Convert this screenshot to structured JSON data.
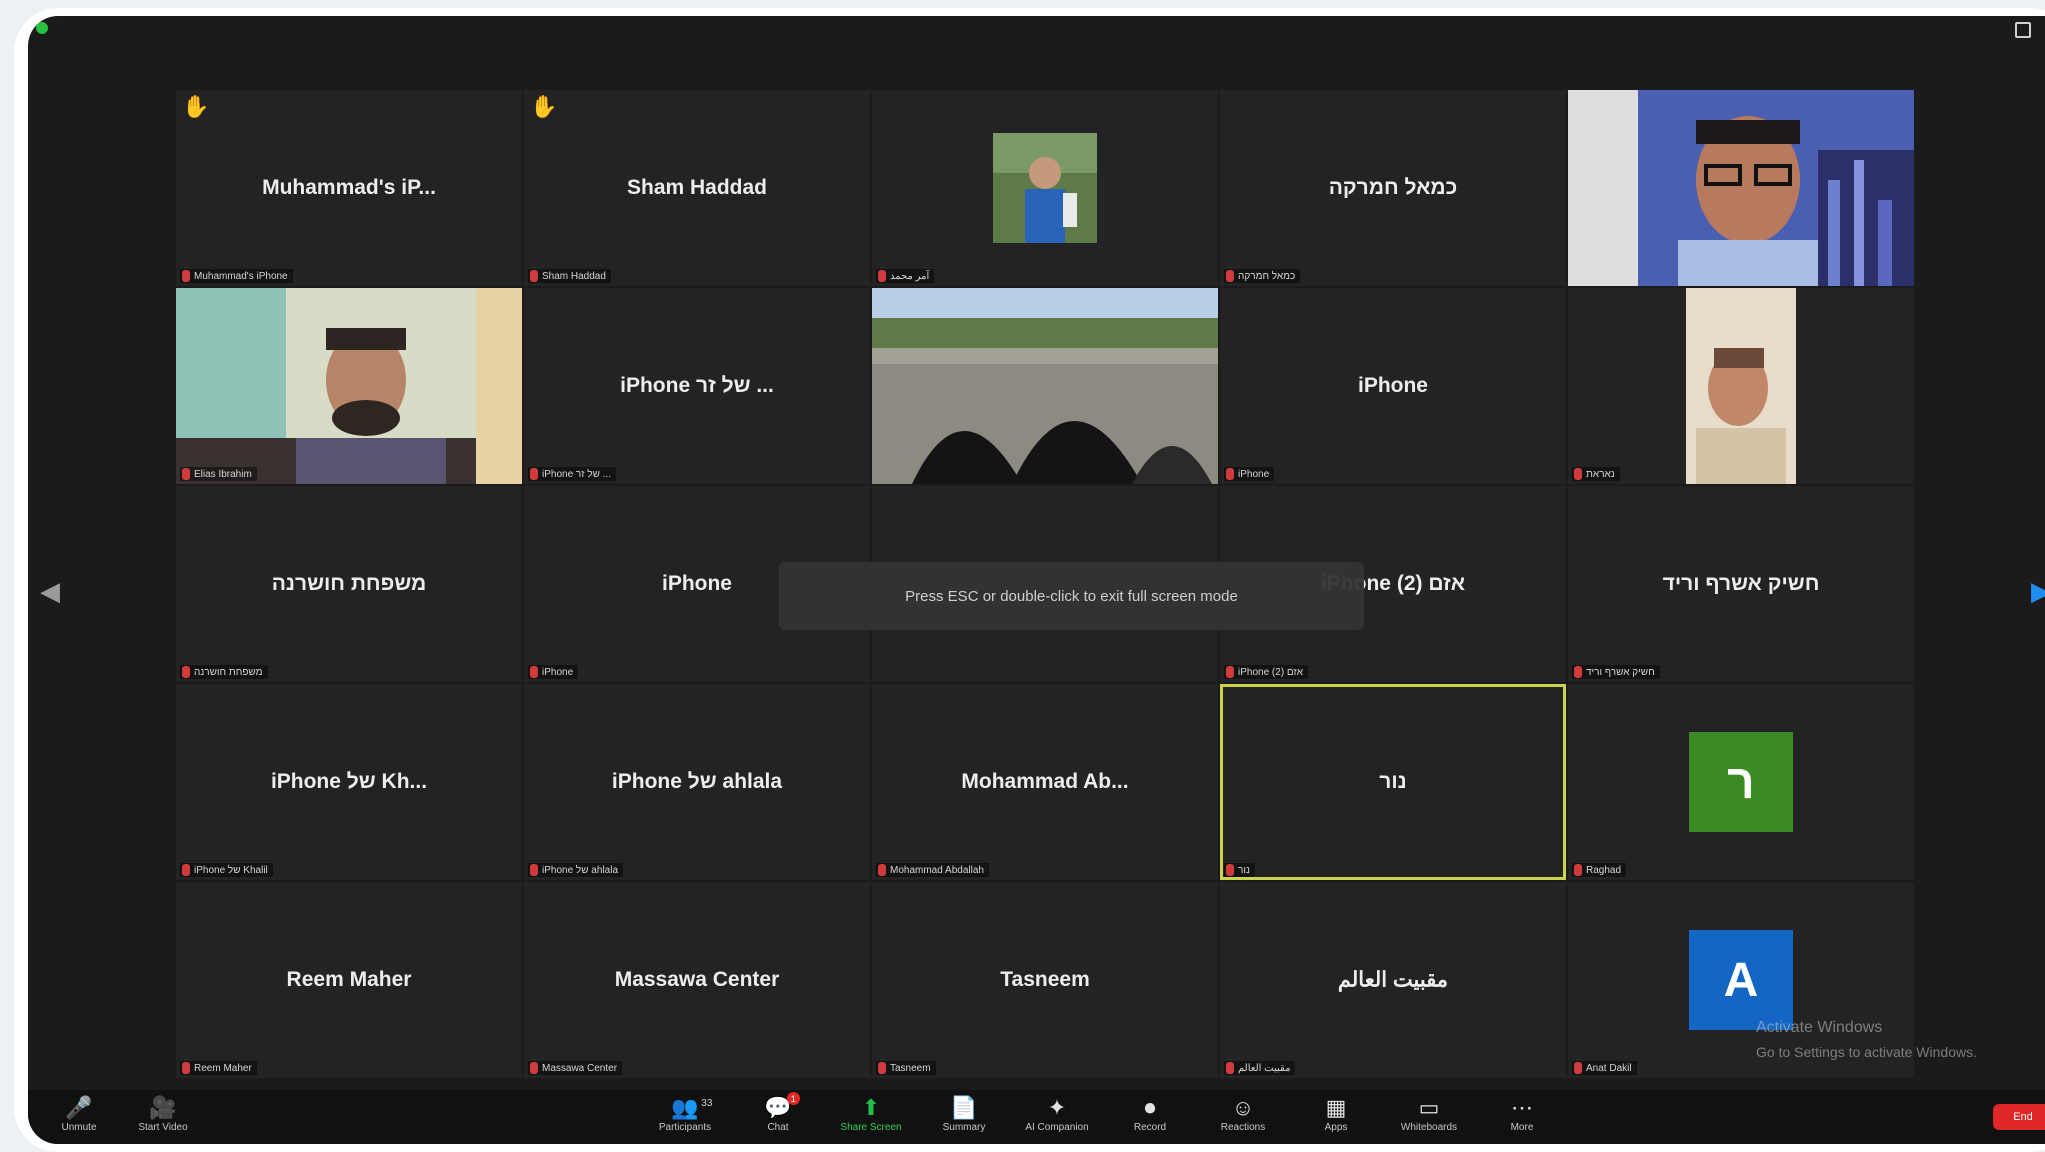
{
  "meeting": {
    "banner": "Press ESC or double-click to exit full screen mode",
    "tiles": [
      {
        "name": "Muhammad's iP...",
        "label": "Muhammad's iPhone",
        "hand": "✋",
        "kind": "text"
      },
      {
        "name": "Sham Haddad",
        "label": "Sham Haddad",
        "hand": "✋",
        "kind": "text"
      },
      {
        "name": "",
        "label": "آمر محمد",
        "kind": "photo-small",
        "photo": "kid"
      },
      {
        "name": "כמאל חמרקה",
        "label": "כמאל חמרקה",
        "kind": "text"
      },
      {
        "name": "",
        "label": "",
        "kind": "photo-full",
        "photo": "man-glasses"
      },
      {
        "name": "",
        "label": "Elias Ibrahim",
        "kind": "photo-full",
        "photo": "man-bearded"
      },
      {
        "name": "iPhone של זר ...",
        "label": "iPhone של זר ...",
        "kind": "text"
      },
      {
        "name": "",
        "label": "",
        "kind": "photo-full",
        "photo": "bridge"
      },
      {
        "name": "iPhone",
        "label": "iPhone",
        "kind": "text"
      },
      {
        "name": "",
        "label": "נאראת",
        "kind": "photo-small",
        "photo": "selfie"
      },
      {
        "name": "משפחת חושרנה",
        "label": "משפחת חושרנה",
        "kind": "text"
      },
      {
        "name": "iPhone",
        "label": "iPhone",
        "kind": "text"
      },
      {
        "name": "",
        "label": "",
        "kind": "text"
      },
      {
        "name": "iPhone אזם (2)",
        "label": "iPhone אזם (2)",
        "kind": "text"
      },
      {
        "name": "חשיק אשרף וריד",
        "label": "חשיק אשרף וריד",
        "kind": "text"
      },
      {
        "name": "iPhone של Kh...",
        "label": "iPhone של Khalil",
        "kind": "text"
      },
      {
        "name": "iPhone של ahlala",
        "label": "iPhone של ahlala",
        "kind": "text"
      },
      {
        "name": "Mohammad Ab...",
        "label": "Mohammad Abdallah",
        "kind": "text"
      },
      {
        "name": "נור",
        "label": "נור",
        "kind": "text",
        "active": true
      },
      {
        "name": "",
        "label": "Raghad",
        "kind": "avatar",
        "initial": "ר",
        "color": "#3b8a23"
      },
      {
        "name": "Reem Maher",
        "label": "Reem Maher",
        "kind": "text"
      },
      {
        "name": "Massawa Center",
        "label": "Massawa Center",
        "kind": "text"
      },
      {
        "name": "Tasneem",
        "label": "Tasneem",
        "kind": "text"
      },
      {
        "name": "مقبيت العالم",
        "label": "مقبيت العالم",
        "kind": "text"
      },
      {
        "name": "",
        "label": "Anat Dakil",
        "kind": "avatar",
        "initial": "A",
        "color": "#1466c4"
      }
    ]
  },
  "watermark": {
    "title": "Activate Windows",
    "subtitle": "Go to Settings to activate Windows."
  },
  "toolbar": {
    "left": [
      {
        "id": "mute",
        "label": "Unmute",
        "icon": "🎤"
      },
      {
        "id": "video",
        "label": "Start Video",
        "icon": "🎥"
      }
    ],
    "center": [
      {
        "id": "participants",
        "label": "Participants",
        "icon": "👥",
        "count": "33"
      },
      {
        "id": "chat",
        "label": "Chat",
        "icon": "💬",
        "badge": "1"
      },
      {
        "id": "share",
        "label": "Share Screen",
        "icon": "⬆"
      },
      {
        "id": "summary",
        "label": "Summary",
        "icon": "📄"
      },
      {
        "id": "companion",
        "label": "AI Companion",
        "icon": "✦"
      },
      {
        "id": "record",
        "label": "Record",
        "icon": "⏺"
      },
      {
        "id": "reactions",
        "label": "Reactions",
        "icon": "☺"
      },
      {
        "id": "apps",
        "label": "Apps",
        "icon": "▦"
      },
      {
        "id": "whiteboards",
        "label": "Whiteboards",
        "icon": "▭"
      },
      {
        "id": "more",
        "label": "More",
        "icon": "⋯"
      }
    ],
    "end_label": "End"
  },
  "colors": {
    "active_outline": "#c9d34e",
    "end_button": "#e02828",
    "share_green": "#1fbf4a"
  }
}
